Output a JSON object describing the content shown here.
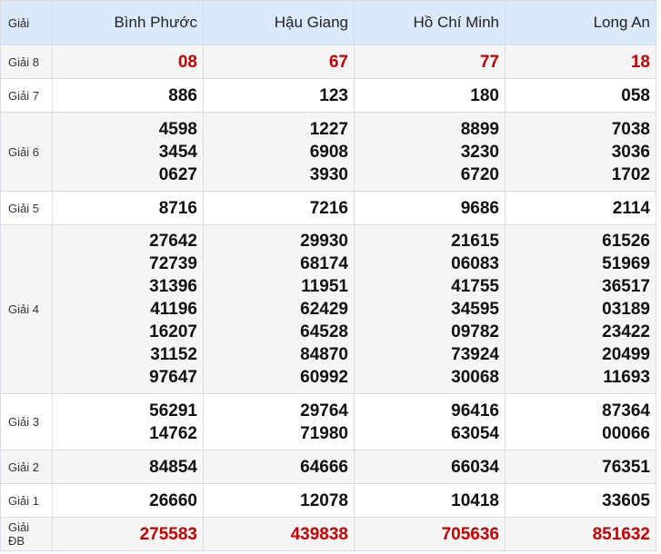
{
  "header": {
    "label": "Giải",
    "provinces": [
      "Bình Phước",
      "Hậu Giang",
      "Hồ Chí Minh",
      "Long An"
    ]
  },
  "rows": [
    {
      "label": "Giải 8",
      "values": [
        [
          "08"
        ],
        [
          "67"
        ],
        [
          "77"
        ],
        [
          "18"
        ]
      ],
      "highlight": "#cc0000"
    },
    {
      "label": "Giải 7",
      "values": [
        [
          "886"
        ],
        [
          "123"
        ],
        [
          "180"
        ],
        [
          "058"
        ]
      ]
    },
    {
      "label": "Giải 6",
      "values": [
        [
          "4598",
          "3454",
          "0627"
        ],
        [
          "1227",
          "6908",
          "3930"
        ],
        [
          "8899",
          "3230",
          "6720"
        ],
        [
          "7038",
          "3036",
          "1702"
        ]
      ]
    },
    {
      "label": "Giải 5",
      "values": [
        [
          "8716"
        ],
        [
          "7216"
        ],
        [
          "9686"
        ],
        [
          "2114"
        ]
      ]
    },
    {
      "label": "Giải 4",
      "values": [
        [
          "27642",
          "72739",
          "31396",
          "41196",
          "16207",
          "31152",
          "97647"
        ],
        [
          "29930",
          "68174",
          "11951",
          "62429",
          "64528",
          "84870",
          "60992"
        ],
        [
          "21615",
          "06083",
          "41755",
          "34595",
          "09782",
          "73924",
          "30068"
        ],
        [
          "61526",
          "51969",
          "36517",
          "03189",
          "23422",
          "20499",
          "11693"
        ]
      ]
    },
    {
      "label": "Giải 3",
      "values": [
        [
          "56291",
          "14762"
        ],
        [
          "29764",
          "71980"
        ],
        [
          "96416",
          "63054"
        ],
        [
          "87364",
          "00066"
        ]
      ]
    },
    {
      "label": "Giải 2",
      "values": [
        [
          "84854"
        ],
        [
          "64666"
        ],
        [
          "66034"
        ],
        [
          "76351"
        ]
      ]
    },
    {
      "label": "Giải 1",
      "values": [
        [
          "26660"
        ],
        [
          "12078"
        ],
        [
          "10418"
        ],
        [
          "33605"
        ]
      ]
    },
    {
      "label": "Giải ĐB",
      "values": [
        [
          "275583"
        ],
        [
          "439838"
        ],
        [
          "705636"
        ],
        [
          "851632"
        ]
      ],
      "highlight": "#cc0000"
    }
  ]
}
